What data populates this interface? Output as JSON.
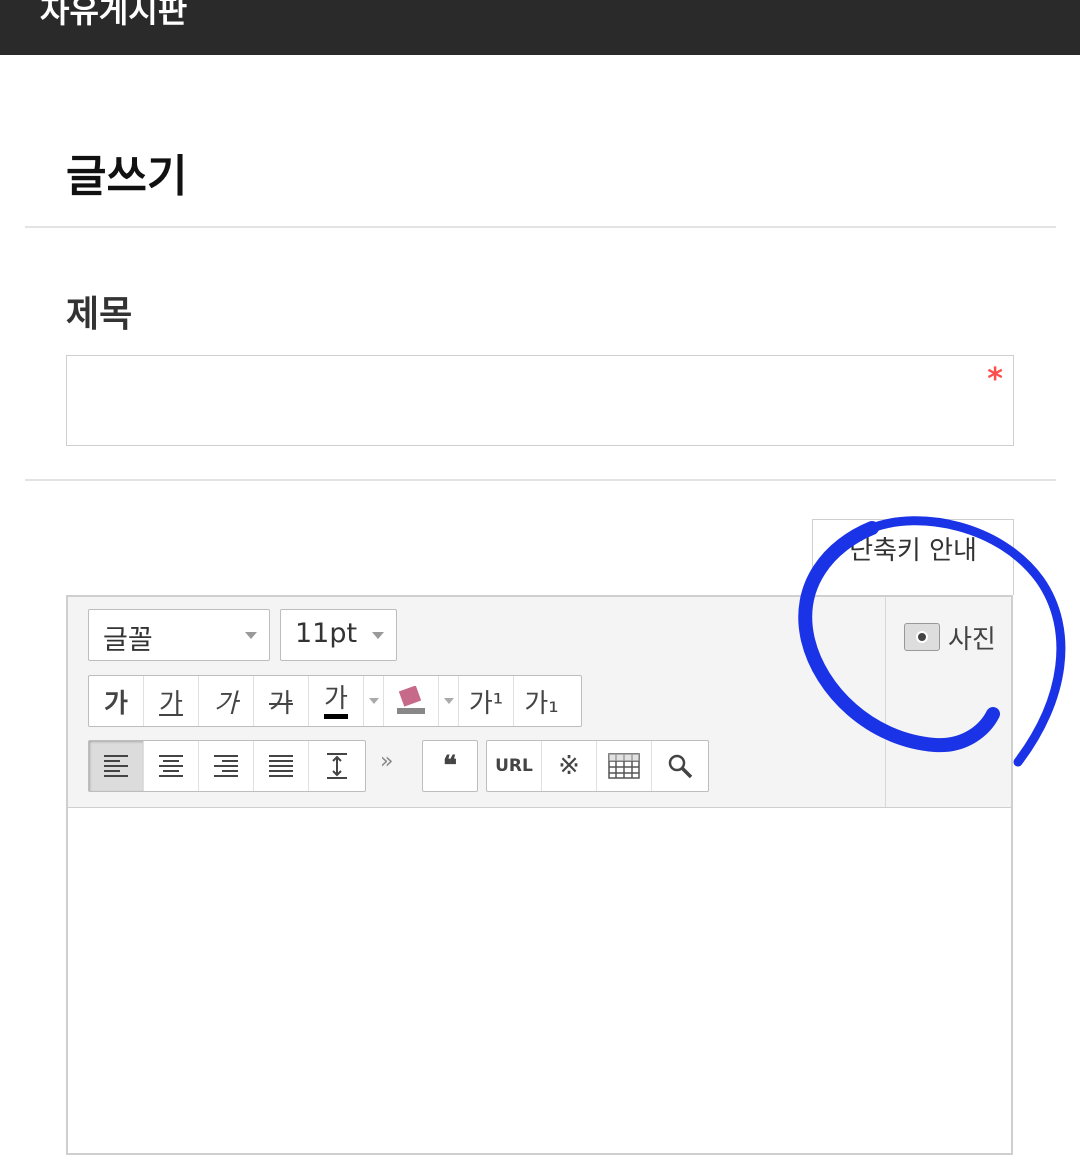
{
  "header": {
    "title": "자유게시판"
  },
  "page": {
    "title": "글쓰기"
  },
  "subject": {
    "label": "제목",
    "value": "",
    "placeholder": "",
    "required_mark": "*"
  },
  "shortcut_button": {
    "label": "단축키 안내"
  },
  "toolbar": {
    "font_select": "글꼴",
    "size_select": "11pt",
    "format_buttons": [
      "가",
      "가",
      "가",
      "가",
      "가"
    ],
    "superscript": "가¹",
    "subscript": "가₁",
    "more": "»",
    "quote": "❝",
    "url": "URL",
    "special_char": "※",
    "photo_label": "사진"
  },
  "colors": {
    "header_bg": "#2a2a2a",
    "required": "#ff4d4d",
    "annotation": "#1a33e6"
  }
}
